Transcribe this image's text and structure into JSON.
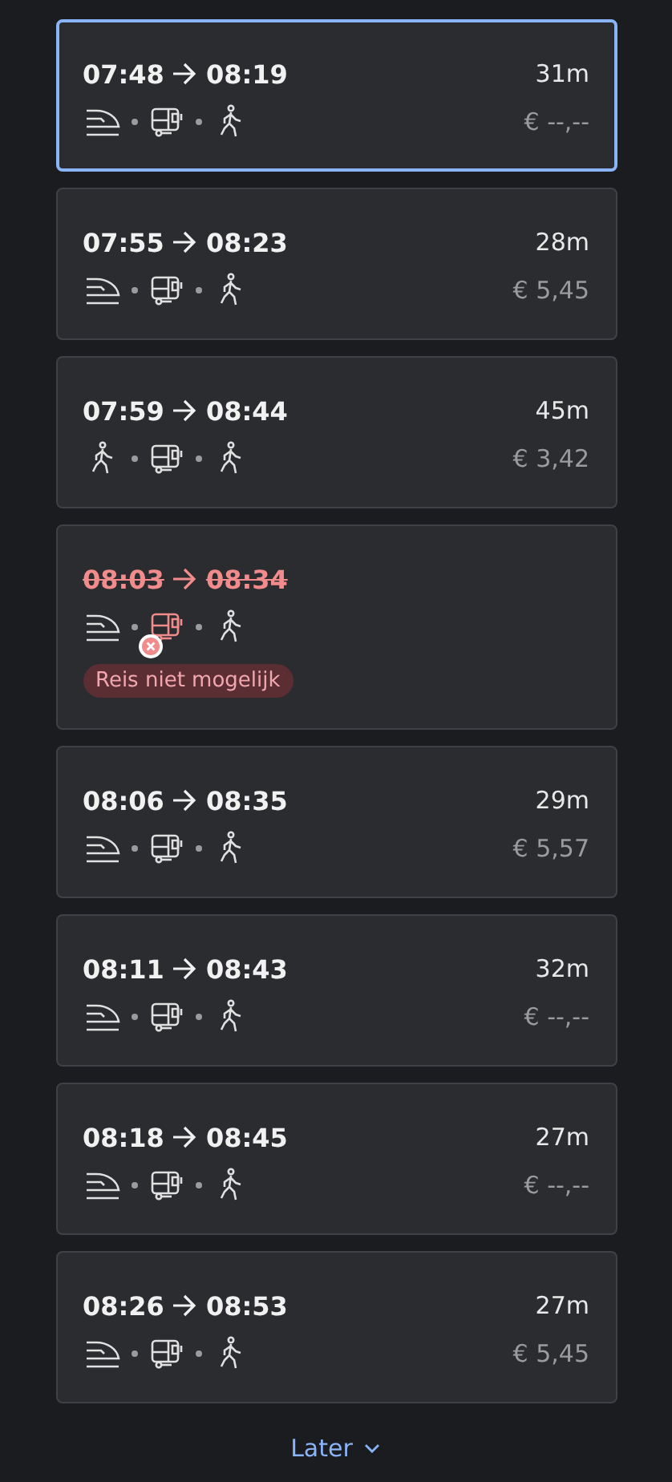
{
  "trips": [
    {
      "depart": "07:48",
      "arrive": "08:19",
      "duration": "31m",
      "price": "€ --,--",
      "selected": true,
      "cancelled": false,
      "legs": [
        {
          "kind": "train",
          "blocked": false
        },
        {
          "kind": "bus",
          "blocked": false
        },
        {
          "kind": "walk",
          "blocked": false
        }
      ]
    },
    {
      "depart": "07:55",
      "arrive": "08:23",
      "duration": "28m",
      "price": "€ 5,45",
      "selected": false,
      "cancelled": false,
      "legs": [
        {
          "kind": "train",
          "blocked": false
        },
        {
          "kind": "bus",
          "blocked": false
        },
        {
          "kind": "walk",
          "blocked": false
        }
      ]
    },
    {
      "depart": "07:59",
      "arrive": "08:44",
      "duration": "45m",
      "price": "€ 3,42",
      "selected": false,
      "cancelled": false,
      "legs": [
        {
          "kind": "walk",
          "blocked": false
        },
        {
          "kind": "bus",
          "blocked": false
        },
        {
          "kind": "walk",
          "blocked": false
        }
      ]
    },
    {
      "depart": "08:03",
      "arrive": "08:34",
      "selected": false,
      "cancelled": true,
      "notice": "Reis niet mogelijk",
      "legs": [
        {
          "kind": "train",
          "blocked": false
        },
        {
          "kind": "bus",
          "blocked": true
        },
        {
          "kind": "walk",
          "blocked": false
        }
      ]
    },
    {
      "depart": "08:06",
      "arrive": "08:35",
      "duration": "29m",
      "price": "€ 5,57",
      "selected": false,
      "cancelled": false,
      "legs": [
        {
          "kind": "train",
          "blocked": false
        },
        {
          "kind": "bus",
          "blocked": false
        },
        {
          "kind": "walk",
          "blocked": false
        }
      ]
    },
    {
      "depart": "08:11",
      "arrive": "08:43",
      "duration": "32m",
      "price": "€ --,--",
      "selected": false,
      "cancelled": false,
      "legs": [
        {
          "kind": "train",
          "blocked": false
        },
        {
          "kind": "bus",
          "blocked": false
        },
        {
          "kind": "walk",
          "blocked": false
        }
      ]
    },
    {
      "depart": "08:18",
      "arrive": "08:45",
      "duration": "27m",
      "price": "€ --,--",
      "selected": false,
      "cancelled": false,
      "legs": [
        {
          "kind": "train",
          "blocked": false
        },
        {
          "kind": "bus",
          "blocked": false
        },
        {
          "kind": "walk",
          "blocked": false
        }
      ]
    },
    {
      "depart": "08:26",
      "arrive": "08:53",
      "duration": "27m",
      "price": "€ 5,45",
      "selected": false,
      "cancelled": false,
      "legs": [
        {
          "kind": "train",
          "blocked": false
        },
        {
          "kind": "bus",
          "blocked": false
        },
        {
          "kind": "walk",
          "blocked": false
        }
      ]
    }
  ],
  "more_button": "Later"
}
